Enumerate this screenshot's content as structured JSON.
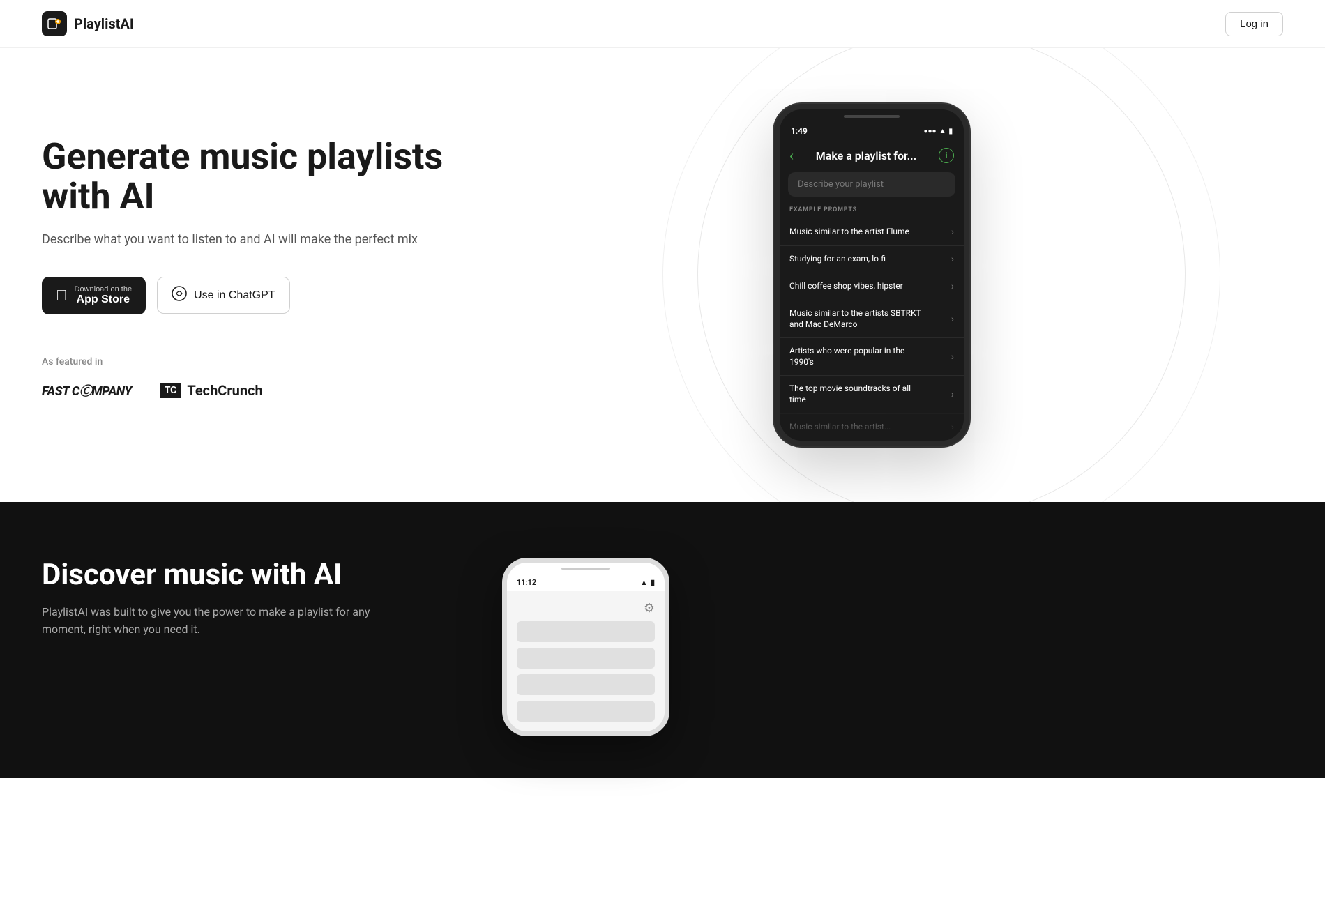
{
  "header": {
    "logo_text": "PlaylistAI",
    "login_label": "Log in"
  },
  "hero": {
    "title": "Generate music playlists with AI",
    "subtitle": "Describe what you want to listen to and AI will make the perfect mix",
    "app_store_button": {
      "top_text": "Download on the",
      "main_text": "App Store"
    },
    "chatgpt_button_label": "Use in ChatGPT",
    "featured_label": "As featured in",
    "featured_publications": [
      {
        "name": "Fast Company",
        "display": "FAST COMPANY"
      },
      {
        "name": "TechCrunch",
        "display": "TechCrunch"
      }
    ]
  },
  "phone_mockup": {
    "status_time": "1:49",
    "header_title": "Make a playlist for...",
    "search_placeholder": "Describe your playlist",
    "section_label": "EXAMPLE PROMPTS",
    "prompts": [
      "Music similar to the artist Flume",
      "Studying for an exam, lo-fi",
      "Chill coffee shop vibes, hipster",
      "Music similar to the artists SBTRKT and Mac DeMarco",
      "Artists who were popular in the 1990's",
      "The top movie soundtracks of all time",
      "Music similar to the artist..."
    ]
  },
  "dark_section": {
    "title": "Discover music with AI",
    "subtitle": "PlaylistAI was built to give you the power to make a playlist for any moment, right when you need it."
  },
  "phone_mockup2": {
    "status_time": "11:12"
  }
}
